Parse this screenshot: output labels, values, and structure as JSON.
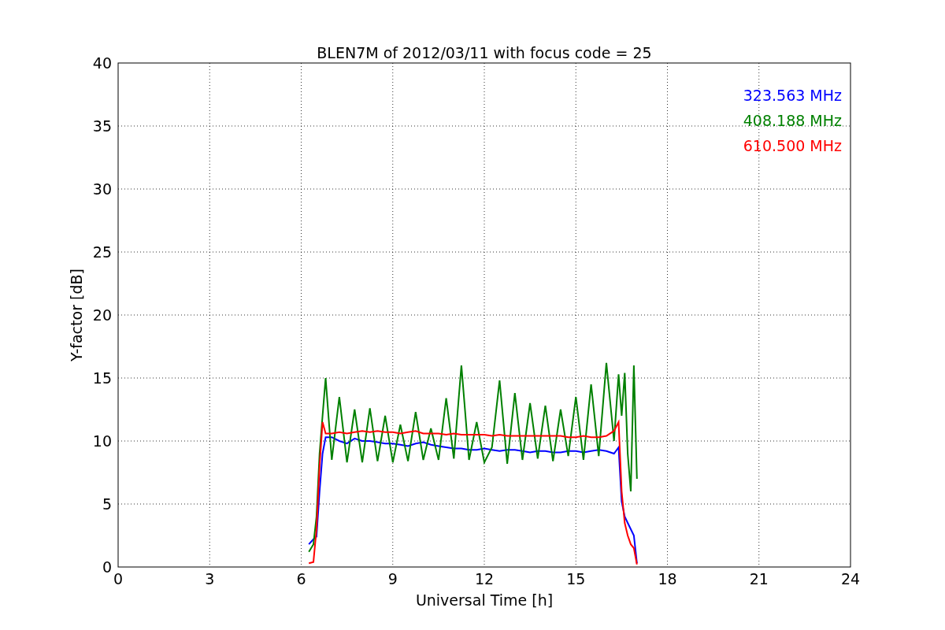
{
  "chart_data": {
    "type": "line",
    "title": "BLEN7M of 2012/03/11 with focus code = 25",
    "xlabel": "Universal Time [h]",
    "ylabel": "Y-factor [dB]",
    "x": [
      6.25,
      6.4,
      6.5,
      6.6,
      6.7,
      6.8,
      7.0,
      7.25,
      7.5,
      7.75,
      8.0,
      8.25,
      8.5,
      8.75,
      9.0,
      9.25,
      9.5,
      9.75,
      10.0,
      10.25,
      10.5,
      10.75,
      11.0,
      11.25,
      11.5,
      11.75,
      12.0,
      12.25,
      12.5,
      12.75,
      13.0,
      13.25,
      13.5,
      13.75,
      14.0,
      14.25,
      14.5,
      14.75,
      15.0,
      15.25,
      15.5,
      15.75,
      16.0,
      16.25,
      16.4,
      16.5,
      16.6,
      16.7,
      16.8,
      16.9,
      17.0
    ],
    "series": [
      {
        "name": "323.563 MHz",
        "color": "#0000ff",
        "values": [
          1.8,
          2.2,
          2.4,
          6,
          9,
          10.3,
          10.3,
          10,
          9.8,
          10.2,
          10,
          10,
          9.9,
          9.8,
          9.8,
          9.7,
          9.6,
          9.8,
          9.9,
          9.7,
          9.6,
          9.5,
          9.4,
          9.4,
          9.3,
          9.3,
          9.4,
          9.3,
          9.2,
          9.3,
          9.3,
          9.2,
          9.1,
          9.2,
          9.2,
          9.1,
          9.1,
          9.2,
          9.2,
          9.1,
          9.2,
          9.3,
          9.2,
          9.0,
          9.5,
          5.2,
          4,
          3.5,
          3,
          2.5,
          0.3
        ]
      },
      {
        "name": "408.188 MHz",
        "color": "#008000",
        "values": [
          1.2,
          1.8,
          4,
          9,
          12,
          15,
          8.5,
          13.5,
          8.3,
          12.5,
          8.3,
          12.6,
          8.4,
          12,
          8.3,
          11.3,
          8.4,
          12.3,
          8.5,
          11,
          8.5,
          13.4,
          8.6,
          16,
          8.5,
          11.5,
          8.3,
          9.5,
          14.8,
          8.2,
          13.8,
          8.5,
          13,
          8.6,
          12.8,
          8.4,
          12.5,
          8.8,
          13.5,
          8.5,
          14.5,
          8.8,
          16.2,
          10,
          15.3,
          12,
          15.4,
          9,
          6,
          16,
          7
        ]
      },
      {
        "name": "610.500 MHz",
        "color": "#ff0000",
        "values": [
          0.3,
          0.4,
          3,
          8,
          11.5,
          10.6,
          10.6,
          10.7,
          10.6,
          10.7,
          10.8,
          10.7,
          10.8,
          10.7,
          10.7,
          10.6,
          10.7,
          10.8,
          10.6,
          10.6,
          10.6,
          10.5,
          10.6,
          10.5,
          10.5,
          10.5,
          10.5,
          10.4,
          10.5,
          10.4,
          10.4,
          10.4,
          10.4,
          10.4,
          10.4,
          10.4,
          10.4,
          10.3,
          10.3,
          10.4,
          10.3,
          10.3,
          10.4,
          10.8,
          11.5,
          6,
          3.5,
          2.5,
          1.8,
          1.5,
          0.2
        ]
      }
    ],
    "grid": true,
    "xlim": [
      0,
      24
    ],
    "ylim": [
      0,
      40
    ],
    "xticks": [
      0,
      3,
      6,
      9,
      12,
      15,
      18,
      21,
      24
    ],
    "yticks": [
      0,
      5,
      10,
      15,
      20,
      25,
      30,
      35,
      40
    ]
  }
}
